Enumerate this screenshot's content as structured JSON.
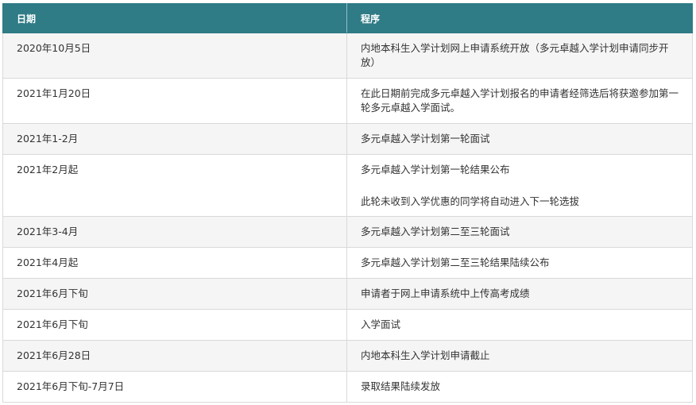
{
  "headers": {
    "date": "日期",
    "process": "程序"
  },
  "rows": [
    {
      "date": "2020年10月5日",
      "process": "内地本科生入学计划网上申请系统开放（多元卓越入学计划申请同步开放）"
    },
    {
      "date": "2021年1月20日",
      "process": "在此日期前完成多元卓越入学计划报名的申请者经筛选后将获邀参加第一轮多元卓越入学面试。"
    },
    {
      "date": "2021年1-2月",
      "process": "多元卓越入学计划第一轮面试"
    },
    {
      "date": "2021年2月起",
      "process": "多元卓越入学计划第一轮结果公布",
      "process_2": "此轮未收到入学优惠的同学将自动进入下一轮选拔"
    },
    {
      "date": "2021年3-4月",
      "process": "多元卓越入学计划第二至三轮面试"
    },
    {
      "date": "2021年4月起",
      "process": "多元卓越入学计划第二至三轮结果陆续公布"
    },
    {
      "date": "2021年6月下旬",
      "process": "申请者于网上申请系统中上传高考成绩"
    },
    {
      "date": "2021年6月下旬",
      "process": "入学面试"
    },
    {
      "date": "2021年6月28日",
      "process": "内地本科生入学计划申请截止"
    },
    {
      "date": "2021年6月下旬-7月7日",
      "process": "录取结果陆续发放"
    }
  ]
}
